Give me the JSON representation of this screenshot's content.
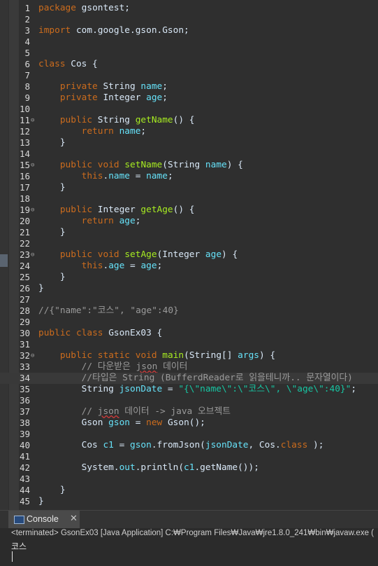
{
  "editor": {
    "lines": [
      {
        "n": "1",
        "fold": "",
        "t": [
          [
            "kw",
            "package"
          ],
          [
            "",
            "gsontest;"
          ]
        ]
      },
      {
        "n": "2",
        "fold": "",
        "t": []
      },
      {
        "n": "3",
        "fold": "",
        "t": [
          [
            "kw",
            "import"
          ],
          [
            "",
            "com.google.gson.Gson;"
          ]
        ]
      },
      {
        "n": "4",
        "fold": "",
        "t": []
      },
      {
        "n": "5",
        "fold": "",
        "t": []
      },
      {
        "n": "6",
        "fold": "",
        "t": [
          [
            "kw",
            "class"
          ],
          [
            "",
            " Cos {"
          ]
        ]
      },
      {
        "n": "7",
        "fold": "",
        "t": []
      },
      {
        "n": "8",
        "fold": "",
        "t": [
          [
            "",
            "    "
          ],
          [
            "kw",
            "private"
          ],
          [
            "",
            " String "
          ],
          [
            "field",
            "name"
          ],
          [
            "",
            ";"
          ]
        ]
      },
      {
        "n": "9",
        "fold": "",
        "t": [
          [
            "",
            "    "
          ],
          [
            "kw",
            "private"
          ],
          [
            "",
            " Integer "
          ],
          [
            "field",
            "age"
          ],
          [
            "",
            ";"
          ]
        ]
      },
      {
        "n": "10",
        "fold": "",
        "t": []
      },
      {
        "n": "11",
        "fold": "⊖",
        "t": [
          [
            "",
            "    "
          ],
          [
            "kw",
            "public"
          ],
          [
            "",
            " String "
          ],
          [
            "method",
            "getName"
          ],
          [
            "",
            "() {"
          ]
        ]
      },
      {
        "n": "12",
        "fold": "",
        "t": [
          [
            "",
            "        "
          ],
          [
            "kw",
            "return"
          ],
          [
            "",
            " "
          ],
          [
            "field",
            "name"
          ],
          [
            "",
            ";"
          ]
        ]
      },
      {
        "n": "13",
        "fold": "",
        "t": [
          [
            "",
            "    }"
          ]
        ]
      },
      {
        "n": "14",
        "fold": "",
        "t": []
      },
      {
        "n": "15",
        "fold": "⊖",
        "t": [
          [
            "",
            "    "
          ],
          [
            "kw",
            "public"
          ],
          [
            "",
            " "
          ],
          [
            "kw",
            "void"
          ],
          [
            "",
            " "
          ],
          [
            "method",
            "setName"
          ],
          [
            "",
            "(String "
          ],
          [
            "field",
            "name"
          ],
          [
            "",
            ") {"
          ]
        ]
      },
      {
        "n": "16",
        "fold": "",
        "t": [
          [
            "",
            "        "
          ],
          [
            "kw",
            "this"
          ],
          [
            "",
            "."
          ],
          [
            "field",
            "name"
          ],
          [
            "",
            " = "
          ],
          [
            "field",
            "name"
          ],
          [
            "",
            ";"
          ]
        ]
      },
      {
        "n": "17",
        "fold": "",
        "t": [
          [
            "",
            "    }"
          ]
        ]
      },
      {
        "n": "18",
        "fold": "",
        "t": []
      },
      {
        "n": "19",
        "fold": "⊖",
        "t": [
          [
            "",
            "    "
          ],
          [
            "kw",
            "public"
          ],
          [
            "",
            " Integer "
          ],
          [
            "method",
            "getAge"
          ],
          [
            "",
            "() {"
          ]
        ]
      },
      {
        "n": "20",
        "fold": "",
        "t": [
          [
            "",
            "        "
          ],
          [
            "kw",
            "return"
          ],
          [
            "",
            " "
          ],
          [
            "field",
            "age"
          ],
          [
            "",
            ";"
          ]
        ]
      },
      {
        "n": "21",
        "fold": "",
        "t": [
          [
            "",
            "    }"
          ]
        ]
      },
      {
        "n": "22",
        "fold": "",
        "t": []
      },
      {
        "n": "23",
        "fold": "⊖",
        "t": [
          [
            "",
            "    "
          ],
          [
            "kw",
            "public"
          ],
          [
            "",
            " "
          ],
          [
            "kw",
            "void"
          ],
          [
            "",
            " "
          ],
          [
            "method",
            "setAge"
          ],
          [
            "",
            "(Integer "
          ],
          [
            "field",
            "age"
          ],
          [
            "",
            ") {"
          ]
        ]
      },
      {
        "n": "24",
        "fold": "",
        "t": [
          [
            "",
            "        "
          ],
          [
            "kw",
            "this"
          ],
          [
            "",
            "."
          ],
          [
            "field",
            "age"
          ],
          [
            "",
            " = "
          ],
          [
            "field",
            "age"
          ],
          [
            "",
            ";"
          ]
        ]
      },
      {
        "n": "25",
        "fold": "",
        "t": [
          [
            "",
            "    }"
          ]
        ]
      },
      {
        "n": "26",
        "fold": "",
        "t": [
          [
            "",
            "}"
          ]
        ]
      },
      {
        "n": "27",
        "fold": "",
        "t": []
      },
      {
        "n": "28",
        "fold": "",
        "t": [
          [
            "cmt",
            "//{\"name\":\"코스\", \"age\":40}"
          ]
        ]
      },
      {
        "n": "29",
        "fold": "",
        "t": []
      },
      {
        "n": "30",
        "fold": "",
        "t": [
          [
            "kw",
            "public"
          ],
          [
            "",
            " "
          ],
          [
            "kw",
            "class"
          ],
          [
            "",
            " GsonEx03 {"
          ]
        ]
      },
      {
        "n": "31",
        "fold": "",
        "t": []
      },
      {
        "n": "32",
        "fold": "⊖",
        "t": [
          [
            "",
            "    "
          ],
          [
            "kw",
            "public"
          ],
          [
            "",
            " "
          ],
          [
            "kw",
            "static"
          ],
          [
            "",
            " "
          ],
          [
            "kw",
            "void"
          ],
          [
            "",
            " "
          ],
          [
            "method",
            "main"
          ],
          [
            "",
            "(String[] "
          ],
          [
            "field",
            "args"
          ],
          [
            "",
            ") {"
          ]
        ]
      },
      {
        "n": "33",
        "fold": "",
        "t": [
          [
            "",
            "        "
          ],
          [
            "cmt",
            "// 다운받은 "
          ],
          [
            "cmtsq",
            "json"
          ],
          [
            "cmt",
            " 데이터"
          ]
        ]
      },
      {
        "n": "34",
        "fold": "",
        "current": true,
        "t": [
          [
            "",
            "        "
          ],
          [
            "cmt",
            "//타입은 String (BufferdReader로 읽을테니까.. 문자열이다)"
          ]
        ]
      },
      {
        "n": "35",
        "fold": "",
        "t": [
          [
            "",
            "        String "
          ],
          [
            "field",
            "jsonDate"
          ],
          [
            "",
            " = "
          ],
          [
            "str",
            "\"{\\\"name\\\":\\\"코스\\\", \\\"age\\\":40}\""
          ],
          [
            "",
            ";"
          ]
        ]
      },
      {
        "n": "36",
        "fold": "",
        "t": []
      },
      {
        "n": "37",
        "fold": "",
        "t": [
          [
            "",
            "        "
          ],
          [
            "cmt",
            "// "
          ],
          [
            "cmtsq",
            "json"
          ],
          [
            "cmt",
            " 데이터 -> java 오브젝트"
          ]
        ]
      },
      {
        "n": "38",
        "fold": "",
        "t": [
          [
            "",
            "        Gson "
          ],
          [
            "field",
            "gson"
          ],
          [
            "",
            " = "
          ],
          [
            "kw",
            "new"
          ],
          [
            "",
            " Gson();"
          ]
        ]
      },
      {
        "n": "39",
        "fold": "",
        "t": []
      },
      {
        "n": "40",
        "fold": "",
        "t": [
          [
            "",
            "        Cos "
          ],
          [
            "field",
            "c1"
          ],
          [
            "",
            " = "
          ],
          [
            "field",
            "gson"
          ],
          [
            "",
            ".fromJson("
          ],
          [
            "field",
            "jsonDate"
          ],
          [
            "",
            ", Cos."
          ],
          [
            "kw",
            "class"
          ],
          [
            "",
            ");"
          ]
        ]
      },
      {
        "n": "41",
        "fold": "",
        "t": []
      },
      {
        "n": "42",
        "fold": "",
        "t": [
          [
            "",
            "        System."
          ],
          [
            "static",
            "out"
          ],
          [
            "",
            ".println("
          ],
          [
            "field",
            "c1"
          ],
          [
            "",
            ".getName());"
          ]
        ]
      },
      {
        "n": "43",
        "fold": "",
        "t": []
      },
      {
        "n": "44",
        "fold": "",
        "t": [
          [
            "",
            "    }"
          ]
        ]
      },
      {
        "n": "45",
        "fold": "",
        "t": [
          [
            "",
            "}"
          ]
        ]
      }
    ]
  },
  "console": {
    "tab_label": "Console",
    "status": "<terminated> GsonEx03 [Java Application] C:₩Program Files₩Java₩jre1.8.0_241₩bin₩javaw.exe (",
    "output": "코스"
  }
}
